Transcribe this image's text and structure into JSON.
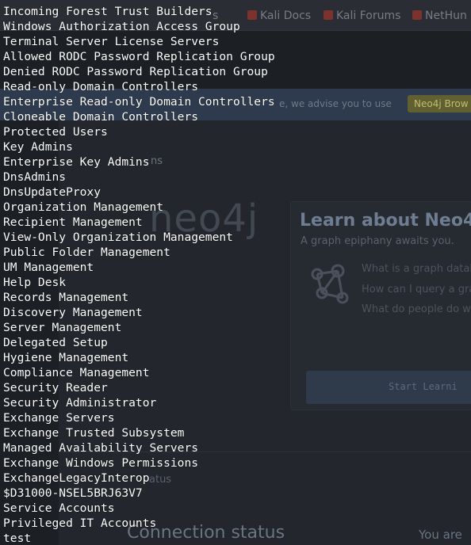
{
  "browser": {
    "bookmarks": [
      {
        "label": "s"
      },
      {
        "label": "Kali Docs"
      },
      {
        "label": "Kali Forums"
      },
      {
        "label": "NetHun"
      }
    ]
  },
  "neo4j": {
    "banner_text": "e, we advise you to use",
    "banner_button": "Neo4j Brow",
    "section_label": "ns",
    "logo_text": "neo4j",
    "card": {
      "title": "Learn about Neo4j",
      "subtitle": "A graph epiphany awaits you.",
      "lines": [
        "What is a graph databa",
        "How can I query a grap",
        "What do people do wi"
      ],
      "button": "Start Learni"
    },
    "section2_label": "atus",
    "connection_title": "Connection status",
    "connection_text": "You are"
  },
  "terminal": {
    "lines": [
      "Incoming Forest Trust Builders",
      "Windows Authorization Access Group",
      "Terminal Server License Servers",
      "Allowed RODC Password Replication Group",
      "Denied RODC Password Replication Group",
      "Read-only Domain Controllers",
      "Enterprise Read-only Domain Controllers",
      "Cloneable Domain Controllers",
      "Protected Users",
      "Key Admins",
      "Enterprise Key Admins",
      "DnsAdmins",
      "DnsUpdateProxy",
      "Organization Management",
      "Recipient Management",
      "View-Only Organization Management",
      "Public Folder Management",
      "UM Management",
      "Help Desk",
      "Records Management",
      "Discovery Management",
      "Server Management",
      "Delegated Setup",
      "Hygiene Management",
      "Compliance Management",
      "Security Reader",
      "Security Administrator",
      "Exchange Servers",
      "Exchange Trusted Subsystem",
      "Managed Availability Servers",
      "Exchange Windows Permissions",
      "ExchangeLegacyInterop",
      "$D31000-NSEL5BRJ63V7",
      "Service Accounts",
      "Privileged IT Accounts",
      "test"
    ]
  }
}
